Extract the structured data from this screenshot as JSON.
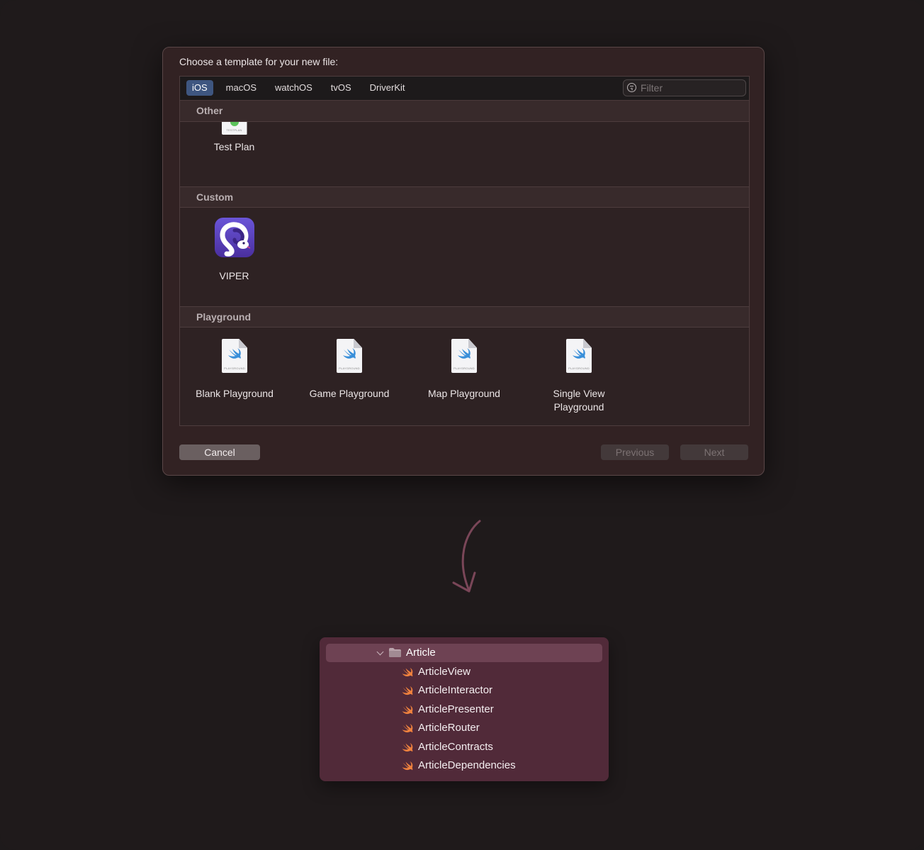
{
  "dialog": {
    "title": "Choose a template for your new file:",
    "platform_tabs": [
      "iOS",
      "macOS",
      "watchOS",
      "tvOS",
      "DriverKit"
    ],
    "active_tab": "iOS",
    "filter_placeholder": "Filter",
    "sections": {
      "other": {
        "header": "Other",
        "items": [
          {
            "label": "Test Plan",
            "icon_caption": "TESTPLAN"
          }
        ]
      },
      "custom": {
        "header": "Custom",
        "items": [
          {
            "label": "VIPER"
          }
        ]
      },
      "playground": {
        "header": "Playground",
        "icon_caption": "PLAYGROUND",
        "items": [
          {
            "label": "Blank Playground"
          },
          {
            "label": "Game Playground"
          },
          {
            "label": "Map Playground"
          },
          {
            "label_line1": "Single View",
            "label_line2": "Playground"
          }
        ]
      }
    },
    "buttons": {
      "cancel": "Cancel",
      "previous": "Previous",
      "next": "Next"
    }
  },
  "project_tree": {
    "folder": "Article",
    "files": [
      "ArticleView",
      "ArticleInteractor",
      "ArticlePresenter",
      "ArticleRouter",
      "ArticleContracts",
      "ArticleDependencies"
    ]
  },
  "colors": {
    "background": "#1f1a1b",
    "dialog": "#322223",
    "active_tab": "#3e5680",
    "tree_background": "#512a39",
    "tree_selection": "#6e4253",
    "swift_orange": "#f0823e",
    "arrow": "#7a4658"
  }
}
